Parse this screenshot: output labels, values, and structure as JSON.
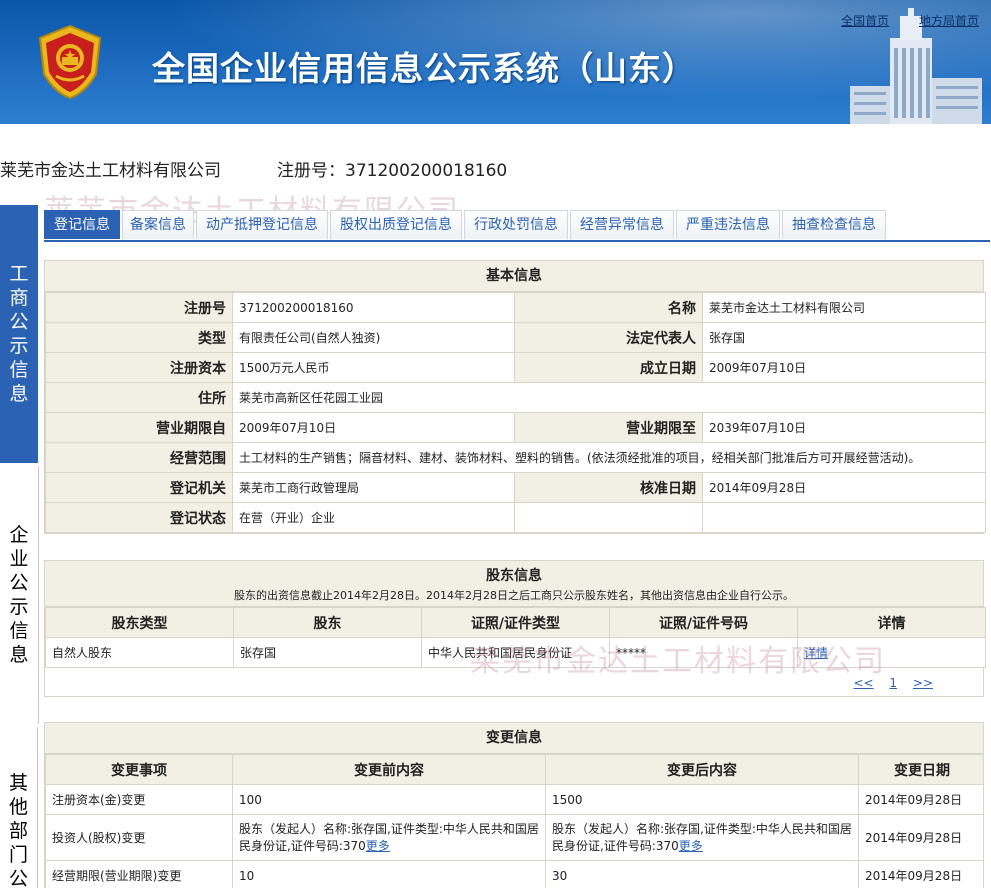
{
  "header": {
    "title": "全国企业信用信息公示系统（山东）",
    "links": [
      "全国首页",
      "地方局首页"
    ]
  },
  "company": {
    "name": "莱芜市金达土工材料有限公司",
    "reg_label": "注册号：",
    "reg_no": "371200200018160",
    "watermark": "莱芜市金达土工材料有限公司"
  },
  "leftnav": [
    "工商公示信息",
    "企业公示信息",
    "其他部门公"
  ],
  "tabs": [
    "登记信息",
    "备案信息",
    "动产抵押登记信息",
    "股权出质登记信息",
    "行政处罚信息",
    "经营异常信息",
    "严重违法信息",
    "抽查检查信息"
  ],
  "basic": {
    "title": "基本信息",
    "rows": [
      {
        "l1": "注册号",
        "v1": "371200200018160",
        "l2": "名称",
        "v2": "莱芜市金达土工材料有限公司"
      },
      {
        "l1": "类型",
        "v1": "有限责任公司(自然人独资)",
        "l2": "法定代表人",
        "v2": "张存国"
      },
      {
        "l1": "注册资本",
        "v1": "1500万元人民币",
        "l2": "成立日期",
        "v2": "2009年07月10日"
      },
      {
        "l1": "住所",
        "v1": "莱芜市高新区任花园工业园"
      },
      {
        "l1": "营业期限自",
        "v1": "2009年07月10日",
        "l2": "营业期限至",
        "v2": "2039年07月10日"
      },
      {
        "l1": "经营范围",
        "v1": "土工材料的生产销售；隔音材料、建材、装饰材料、塑料的销售。(依法须经批准的项目，经相关部门批准后方可开展经营活动)。"
      },
      {
        "l1": "登记机关",
        "v1": "莱芜市工商行政管理局",
        "l2": "核准日期",
        "v2": "2014年09月28日"
      },
      {
        "l1": "登记状态",
        "v1": "在营（开业）企业",
        "l2": "",
        "v2": ""
      }
    ]
  },
  "shareholders": {
    "title": "股东信息",
    "note": "股东的出资信息截止2014年2月28日。2014年2月28日之后工商只公示股东姓名，其他出资信息由企业自行公示。",
    "headers": [
      "股东类型",
      "股东",
      "证照/证件类型",
      "证照/证件号码",
      "详情"
    ],
    "rows": [
      [
        "自然人股东",
        "张存国",
        "中华人民共和国居民身份证",
        "*****",
        "详情"
      ]
    ],
    "pager": [
      "<<",
      "1",
      ">>"
    ]
  },
  "changes": {
    "title": "变更信息",
    "headers": [
      "变更事项",
      "变更前内容",
      "变更后内容",
      "变更日期"
    ],
    "more": "更多",
    "rows": [
      {
        "item": "注册资本(金)变更",
        "before": "100",
        "after": "1500",
        "date": "2014年09月28日"
      },
      {
        "item": "投资人(股权)变更",
        "before": "股东（发起人）名称:张存国,证件类型:中华人民共和国居民身份证,证件号码:370",
        "after": "股东（发起人）名称:张存国,证件类型:中华人民共和国居民身份证,证件号码:370",
        "date": "2014年09月28日"
      },
      {
        "item": "经营期限(营业期限)变更",
        "before": "10",
        "after": "30",
        "date": "2014年09月28日"
      }
    ]
  }
}
